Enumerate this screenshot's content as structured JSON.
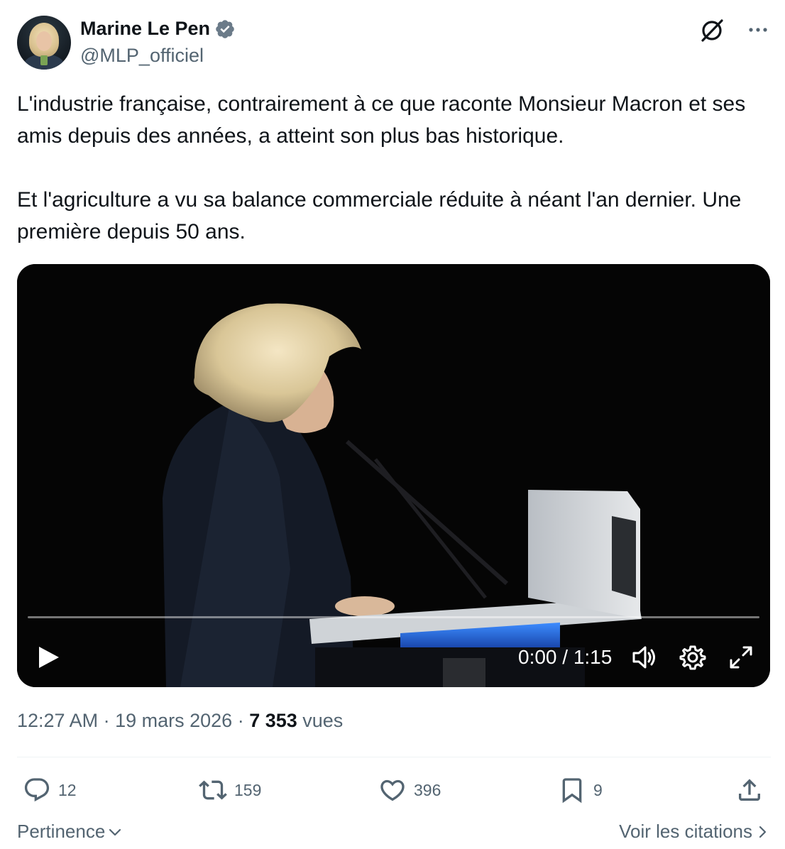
{
  "author": {
    "display_name": "Marine Le Pen",
    "handle": "@MLP_officiel",
    "verified": true
  },
  "tweet": {
    "text": "L'industrie française, contrairement à ce que raconte Monsieur Macron et ses amis depuis des années, a atteint son plus bas historique.\n\nEt l'agriculture a vu sa balance commerciale réduite à néant l'an dernier. Une première depuis 50 ans."
  },
  "video": {
    "time_readout": "0:00 / 1:15",
    "progress": 0
  },
  "meta": {
    "time": "12:27 AM",
    "separator": " · ",
    "date": "19 mars 2026",
    "views_count": "7 353",
    "views_label": " vues"
  },
  "actions": {
    "replies": "12",
    "reposts": "159",
    "likes": "396",
    "bookmarks": "9"
  },
  "footer": {
    "sort_label": "Pertinence",
    "quotes_link": "Voir les citations"
  },
  "colors": {
    "text_primary": "#0f1419",
    "text_secondary": "#536471",
    "verified_blue": "#1d9bf0",
    "divider": "#eff3f4"
  },
  "icons": [
    "grok-icon",
    "more-icon",
    "verified-icon",
    "play-icon",
    "volume-icon",
    "settings-icon",
    "fullscreen-icon",
    "reply-icon",
    "retweet-icon",
    "like-icon",
    "bookmark-icon",
    "share-icon",
    "chevron-down-icon",
    "chevron-right-icon"
  ]
}
